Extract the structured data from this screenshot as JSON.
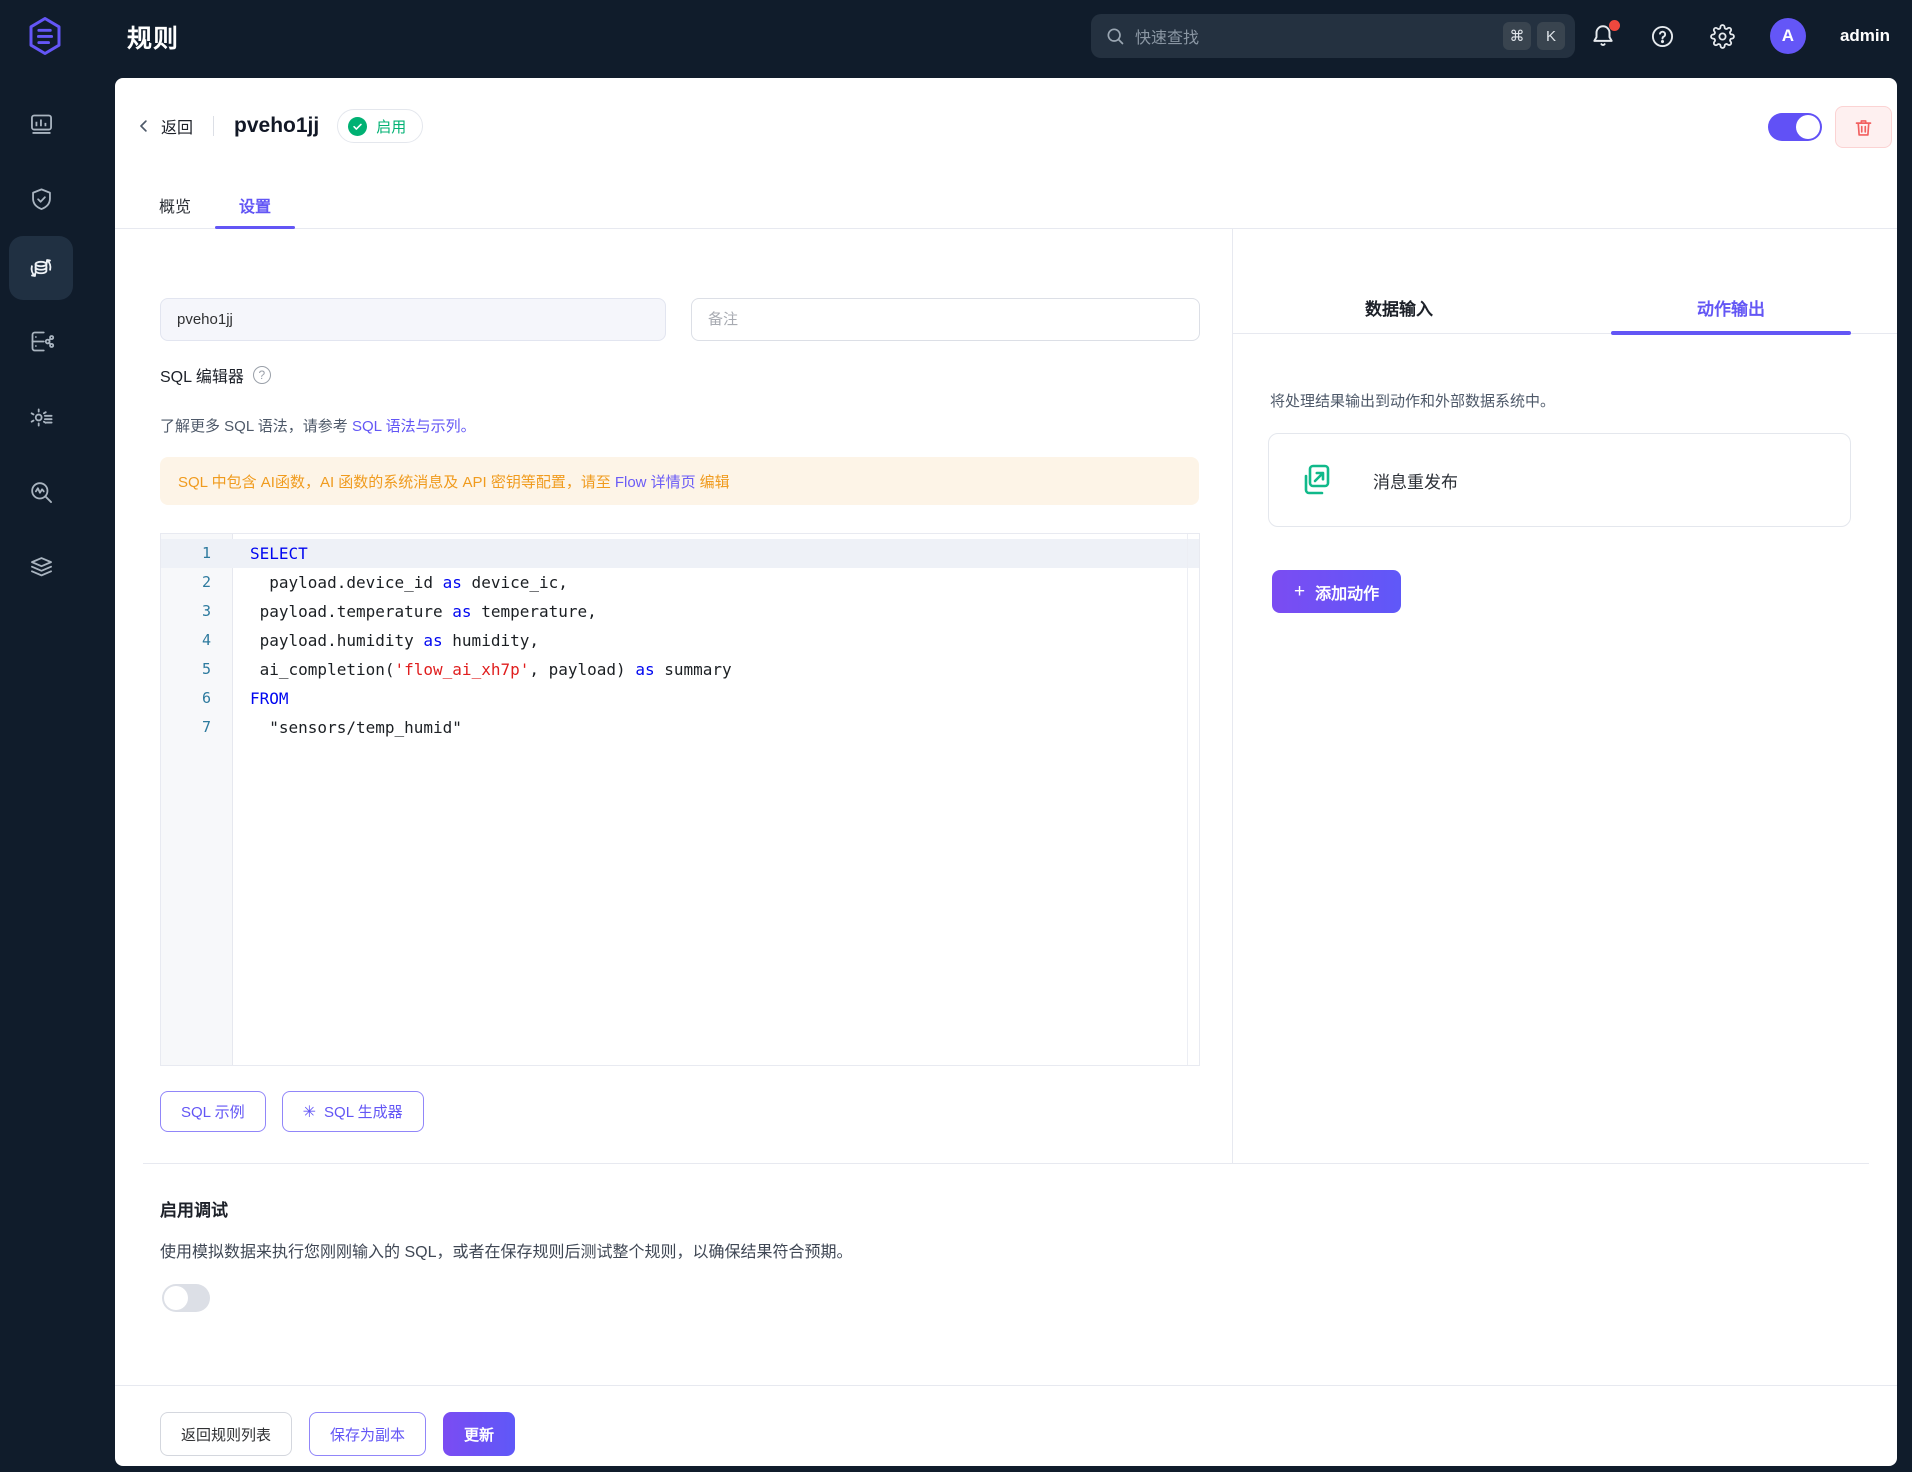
{
  "colors": {
    "accent_purple": "#6356f5",
    "brand_green": "#00b173",
    "warning_orange": "#f09b1e",
    "danger_red": "#f25f5f",
    "dark_navy": "#101c2b",
    "code_keyword": "#0006f0",
    "code_string": "#e01e1e",
    "code_line_number": "#2d7a9e"
  },
  "topbar": {
    "title": "规则",
    "search_placeholder": "快速查找",
    "shortcut_mod": "⌘",
    "shortcut_key": "K",
    "avatar_letter": "A",
    "username": "admin",
    "icons": [
      "search-icon",
      "bell-icon",
      "help-icon",
      "gear-icon"
    ]
  },
  "sidebar": {
    "active_index": 2,
    "items": [
      {
        "icon": "dashboard-icon"
      },
      {
        "icon": "shield-check-icon"
      },
      {
        "icon": "rule-engine-icon"
      },
      {
        "icon": "data-integration-icon"
      },
      {
        "icon": "gear-services-icon"
      },
      {
        "icon": "diagnose-icon"
      },
      {
        "icon": "layers-icon"
      }
    ]
  },
  "header": {
    "back_label": "返回",
    "rule_name": "pveho1jj",
    "status_label": "启用",
    "tab_overview": "概览",
    "tab_settings": "设置"
  },
  "form": {
    "name_value": "pveho1jj",
    "remark_placeholder": "备注"
  },
  "sql": {
    "label": "SQL 编辑器",
    "help_mark": "?",
    "hint_prefix": "了解更多 SQL 语法，请参考 ",
    "hint_link": "SQL 语法与示列。",
    "warning_prefix": "SQL 中包含 AI函数，AI 函数的系统消息及 API 密钥等配置，请至",
    "warning_link": "Flow 详情页",
    "warning_suffix": "编辑",
    "example_button": "SQL 示例",
    "generator_button": "SQL 生成器",
    "generator_icon": "✳",
    "code_lines": [
      [
        {
          "t": "SELECT",
          "c": "kw"
        }
      ],
      [
        {
          "t": "  payload.device_id ",
          "c": "p"
        },
        {
          "t": "as",
          "c": "kw"
        },
        {
          "t": " device_ic,",
          "c": "p"
        }
      ],
      [
        {
          "t": " payload.temperature ",
          "c": "p"
        },
        {
          "t": "as",
          "c": "kw"
        },
        {
          "t": " temperature,",
          "c": "p"
        }
      ],
      [
        {
          "t": " payload.humidity ",
          "c": "p"
        },
        {
          "t": "as",
          "c": "kw"
        },
        {
          "t": " humidity,",
          "c": "p"
        }
      ],
      [
        {
          "t": " ai_completion(",
          "c": "p"
        },
        {
          "t": "'flow_ai_xh7p'",
          "c": "str"
        },
        {
          "t": ", payload) ",
          "c": "p"
        },
        {
          "t": "as",
          "c": "kw"
        },
        {
          "t": " summary",
          "c": "p"
        }
      ],
      [
        {
          "t": "FROM",
          "c": "kw"
        }
      ],
      [
        {
          "t": "  \"sensors/temp_humid\"",
          "c": "p"
        }
      ]
    ]
  },
  "output": {
    "tab_input": "数据输入",
    "tab_output": "动作输出",
    "description": "将处理结果输出到动作和外部数据系统中。",
    "action_card_label": "消息重发布",
    "action_card_icon": "republish-icon",
    "add_action_label": "添加动作"
  },
  "debug": {
    "title": "启用调试",
    "description": "使用模拟数据来执行您刚刚输入的 SQL，或者在保存规则后测试整个规则，以确保结果符合预期。"
  },
  "footer": {
    "back_button": "返回规则列表",
    "copy_button": "保存为副本",
    "update_button": "更新"
  }
}
